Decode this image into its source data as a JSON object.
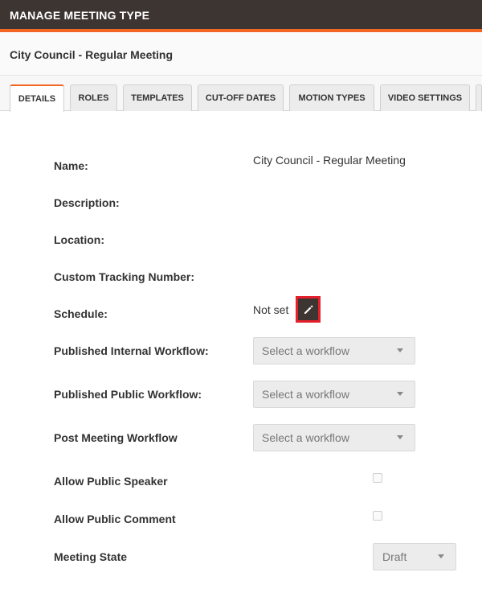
{
  "header": {
    "title": "MANAGE MEETING TYPE"
  },
  "subheader": {
    "title": "City Council - Regular Meeting"
  },
  "tabs": [
    {
      "label": "DETAILS",
      "active": true
    },
    {
      "label": "ROLES"
    },
    {
      "label": "TEMPLATES"
    },
    {
      "label": "CUT-OFF DATES"
    },
    {
      "label": "MOTION TYPES"
    },
    {
      "label": "VIDEO SETTINGS"
    }
  ],
  "form": {
    "name": {
      "label": "Name:",
      "value": "City Council - Regular Meeting"
    },
    "description": {
      "label": "Description:"
    },
    "location": {
      "label": "Location:"
    },
    "tracking": {
      "label": "Custom Tracking Number:"
    },
    "schedule": {
      "label": "Schedule:",
      "value": "Not set",
      "edit_icon": "pencil-icon"
    },
    "internal_workflow": {
      "label": "Published Internal Workflow:",
      "placeholder": "Select a workflow"
    },
    "public_workflow": {
      "label": "Published Public Workflow:",
      "placeholder": "Select a workflow"
    },
    "post_workflow": {
      "label": "Post Meeting Workflow",
      "placeholder": "Select a workflow"
    },
    "public_speaker": {
      "label": "Allow Public Speaker",
      "checked": false
    },
    "public_comment": {
      "label": "Allow Public Comment",
      "checked": false
    },
    "meeting_state": {
      "label": "Meeting State",
      "value": "Draft"
    }
  },
  "colors": {
    "accent": "#f26522",
    "header_bg": "#3d3532",
    "highlight": "#e3202b"
  }
}
